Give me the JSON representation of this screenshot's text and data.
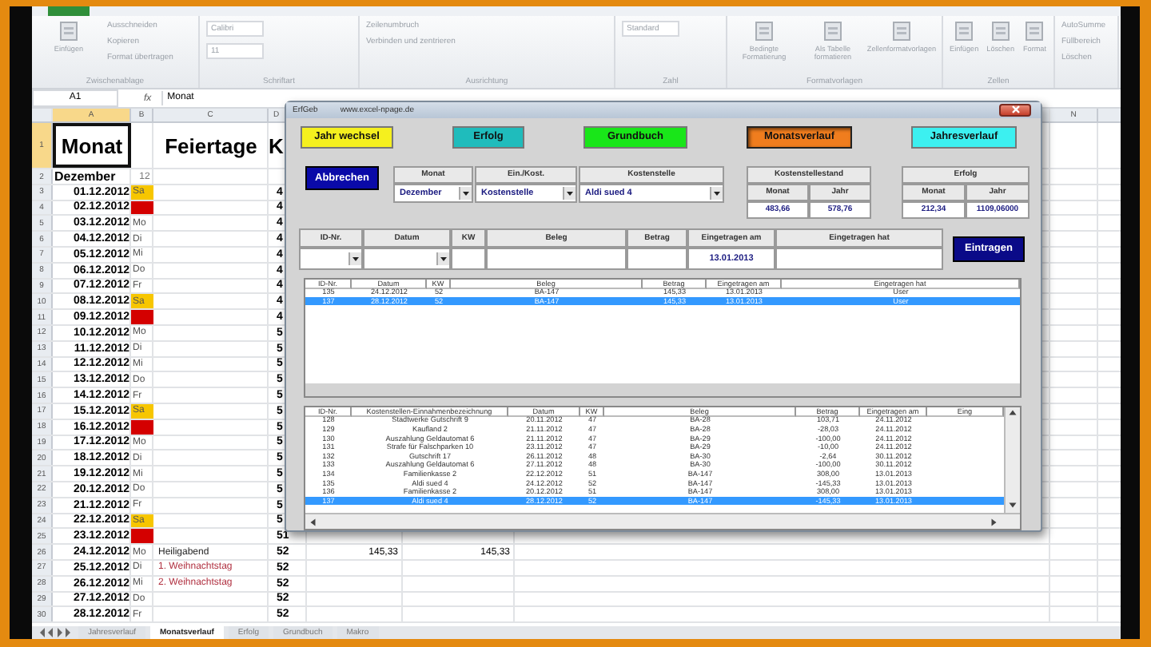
{
  "ribbon": {
    "groups": [
      {
        "label": "Zwischenablage",
        "items": [
          {
            "kind": "large",
            "label": "Einfügen"
          },
          {
            "kind": "small",
            "label": "Ausschneiden"
          },
          {
            "kind": "small",
            "label": "Kopieren"
          },
          {
            "kind": "small",
            "label": "Format übertragen"
          }
        ]
      },
      {
        "label": "Schriftart",
        "items": [
          {
            "kind": "field",
            "label": "Calibri"
          },
          {
            "kind": "field",
            "label": "11"
          }
        ]
      },
      {
        "label": "Ausrichtung",
        "items": [
          {
            "kind": "small",
            "label": "Zeilenumbruch"
          },
          {
            "kind": "small",
            "label": "Verbinden und zentrieren"
          }
        ]
      },
      {
        "label": "Zahl",
        "items": [
          {
            "kind": "field",
            "label": "Standard"
          }
        ]
      },
      {
        "label": "Formatvorlagen",
        "items": [
          {
            "kind": "large",
            "label": "Bedingte Formatierung"
          },
          {
            "kind": "large",
            "label": "Als Tabelle formatieren"
          },
          {
            "kind": "large",
            "label": "Zellenformatvorlagen"
          }
        ]
      },
      {
        "label": "Zellen",
        "items": [
          {
            "kind": "large",
            "label": "Einfügen"
          },
          {
            "kind": "large",
            "label": "Löschen"
          },
          {
            "kind": "large",
            "label": "Format"
          }
        ]
      },
      {
        "items": [
          {
            "kind": "small",
            "label": "AutoSumme"
          },
          {
            "kind": "small",
            "label": "Füllbereich"
          },
          {
            "kind": "small",
            "label": "Löschen"
          }
        ]
      }
    ]
  },
  "formula_bar": {
    "name_box": "A1",
    "function_symbol": "fx",
    "value": "Monat"
  },
  "columns": [
    {
      "label": "A",
      "selected": true
    },
    {
      "label": "B",
      "selected": false
    },
    {
      "label": "C",
      "selected": false
    },
    {
      "label": "D",
      "selected": false
    },
    {
      "label": "N",
      "selected": false
    }
  ],
  "title_row": {
    "num": "1",
    "selected": true,
    "month": "Monat",
    "holidays": "Feiertage",
    "kw": "K"
  },
  "month_row": {
    "num": "2",
    "month": "Dezember",
    "number": "12"
  },
  "rows": [
    {
      "num": "3",
      "date": "01.12.2012",
      "kind": "sa",
      "day": "Sa",
      "kw": "4"
    },
    {
      "num": "4",
      "date": "02.12.2012",
      "kind": "so",
      "kw": "4"
    },
    {
      "num": "5",
      "date": "03.12.2012",
      "kind": "weekday",
      "day": "Mo",
      "kw": "4"
    },
    {
      "num": "6",
      "date": "04.12.2012",
      "kind": "weekday",
      "day": "Di",
      "kw": "4"
    },
    {
      "num": "7",
      "date": "05.12.2012",
      "kind": "weekday",
      "day": "Mi",
      "kw": "4"
    },
    {
      "num": "8",
      "date": "06.12.2012",
      "kind": "weekday",
      "day": "Do",
      "kw": "4"
    },
    {
      "num": "9",
      "date": "07.12.2012",
      "kind": "weekday",
      "day": "Fr",
      "kw": "4"
    },
    {
      "num": "10",
      "date": "08.12.2012",
      "kind": "sa",
      "day": "Sa",
      "kw": "4"
    },
    {
      "num": "11",
      "date": "09.12.2012",
      "kind": "so",
      "kw": "4"
    },
    {
      "num": "12",
      "date": "10.12.2012",
      "kind": "weekday",
      "day": "Mo",
      "kw": "5"
    },
    {
      "num": "13",
      "date": "11.12.2012",
      "kind": "weekday",
      "day": "Di",
      "kw": "5"
    },
    {
      "num": "14",
      "date": "12.12.2012",
      "kind": "weekday",
      "day": "Mi",
      "kw": "5"
    },
    {
      "num": "15",
      "date": "13.12.2012",
      "kind": "weekday",
      "day": "Do",
      "kw": "5"
    },
    {
      "num": "16",
      "date": "14.12.2012",
      "kind": "weekday",
      "day": "Fr",
      "kw": "5"
    },
    {
      "num": "17",
      "date": "15.12.2012",
      "kind": "sa",
      "day": "Sa",
      "kw": "5"
    },
    {
      "num": "18",
      "date": "16.12.2012",
      "kind": "so",
      "kw": "5"
    },
    {
      "num": "19",
      "date": "17.12.2012",
      "kind": "weekday",
      "day": "Mo",
      "kw": "5"
    },
    {
      "num": "20",
      "date": "18.12.2012",
      "kind": "weekday",
      "day": "Di",
      "kw": "5"
    },
    {
      "num": "21",
      "date": "19.12.2012",
      "kind": "weekday",
      "day": "Mi",
      "kw": "5"
    },
    {
      "num": "22",
      "date": "20.12.2012",
      "kind": "weekday",
      "day": "Do",
      "kw": "5"
    },
    {
      "num": "23",
      "date": "21.12.2012",
      "kind": "weekday",
      "day": "Fr",
      "kw": "5"
    },
    {
      "num": "24",
      "date": "22.12.2012",
      "kind": "sa",
      "day": "Sa",
      "kw": "5"
    },
    {
      "num": "25",
      "date": "23.12.2012",
      "kind": "so",
      "kw": "51"
    },
    {
      "num": "26",
      "date": "24.12.2012",
      "kind": "weekday",
      "day": "Mo",
      "holiday": "Heiligabend",
      "color": "#222222",
      "kw": "52",
      "value_e": "145,33",
      "value_f": "145,33"
    },
    {
      "num": "27",
      "date": "25.12.2012",
      "kind": "weekday",
      "day": "Di",
      "holiday": "1. Weihnachtstag",
      "color": "#b03040",
      "kw": "52"
    },
    {
      "num": "28",
      "date": "26.12.2012",
      "kind": "weekday",
      "day": "Mi",
      "holiday": "2. Weihnachtstag",
      "color": "#b03040",
      "kw": "52"
    },
    {
      "num": "29",
      "date": "27.12.2012",
      "kind": "weekday",
      "day": "Do",
      "kw": "52"
    },
    {
      "num": "30",
      "date": "28.12.2012",
      "kind": "weekday",
      "day": "Fr",
      "kw": "52"
    }
  ],
  "sheet_tabs": [
    {
      "label": "Jahresverlauf",
      "selected": false
    },
    {
      "label": "Monatsverlauf",
      "selected": true
    },
    {
      "label": "Erfolg",
      "selected": false
    },
    {
      "label": "Grundbuch",
      "selected": false
    },
    {
      "label": "Makro",
      "selected": false
    }
  ],
  "form": {
    "title": "ErfGeb",
    "url": "www.excel-npage.de",
    "nav_buttons": [
      {
        "label": "Jahr wechsel",
        "color": "#f5f01e",
        "selected": false
      },
      {
        "label": "Erfolg",
        "color": "#1fbcbc",
        "selected": false
      },
      {
        "label": "Grundbuch",
        "color": "#19e619",
        "selected": false
      },
      {
        "label": "Monatsverlauf",
        "color": "#f07d1e",
        "selected": true
      },
      {
        "label": "Jahresverlauf",
        "color": "#3cf0f0",
        "selected": false
      }
    ],
    "cancel_button": "Abbrechen",
    "filters": [
      {
        "label": "Monat",
        "value": "Dezember"
      },
      {
        "label": "Ein./Kost.",
        "value": "Kostenstelle"
      },
      {
        "label": "Kostenstelle",
        "value": "Aldi sued 4"
      }
    ],
    "balance": {
      "title": "Kostenstellestand",
      "columns": [
        "Monat",
        "Jahr"
      ],
      "values": [
        "483,66",
        "578,76"
      ]
    },
    "result": {
      "title": "Erfolg",
      "columns": [
        "Monat",
        "Jahr"
      ],
      "values": [
        "212,34",
        "1109,06000"
      ]
    },
    "entry": {
      "fields": [
        {
          "label": "ID-Nr.",
          "kind": "combo"
        },
        {
          "label": "Datum",
          "kind": "combo"
        },
        {
          "label": "KW",
          "kind": "text"
        },
        {
          "label": "Beleg",
          "kind": "text"
        },
        {
          "label": "Betrag",
          "kind": "text"
        },
        {
          "label": "Eingetragen am",
          "kind": "text",
          "value": "13.01.2013"
        },
        {
          "label": "Eingetragen hat",
          "kind": "text"
        }
      ],
      "submit": "Eintragen"
    },
    "list_1": {
      "columns": [
        "ID-Nr.",
        "Datum",
        "KW",
        "Beleg",
        "Betrag",
        "Eingetragen am",
        "Eingetragen hat"
      ],
      "rows": [
        {
          "cells": [
            "135",
            "24.12.2012",
            "52",
            "BA-147",
            "145,33",
            "13.01.2013",
            "User"
          ],
          "selected": false
        },
        {
          "cells": [
            "137",
            "28.12.2012",
            "52",
            "BA-147",
            "145,33",
            "13.01.2013",
            "User"
          ],
          "selected": true
        }
      ]
    },
    "list_2": {
      "columns": [
        "ID-Nr.",
        "Kostenstellen-Einnahmenbezeichnung",
        "Datum",
        "KW",
        "Beleg",
        "Betrag",
        "Eingetragen am",
        "Eing"
      ],
      "rows": [
        {
          "cells": [
            "128",
            "Stadtwerke Gutschrift 9",
            "20.11.2012",
            "47",
            "BA-28",
            "103,71",
            "24.11.2012"
          ],
          "selected": false
        },
        {
          "cells": [
            "129",
            "Kaufland 2",
            "21.11.2012",
            "47",
            "BA-28",
            "-28,03",
            "24.11.2012"
          ],
          "selected": false
        },
        {
          "cells": [
            "130",
            "Auszahlung Geldautomat 6",
            "21.11.2012",
            "47",
            "BA-29",
            "-100,00",
            "24.11.2012"
          ],
          "selected": false
        },
        {
          "cells": [
            "131",
            "Strafe für Falschparken 10",
            "23.11.2012",
            "47",
            "BA-29",
            "-10,00",
            "24.11.2012"
          ],
          "selected": false
        },
        {
          "cells": [
            "132",
            "Gutschrift 17",
            "26.11.2012",
            "48",
            "BA-30",
            "-2,64",
            "30.11.2012"
          ],
          "selected": false
        },
        {
          "cells": [
            "133",
            "Auszahlung Geldautomat 6",
            "27.11.2012",
            "48",
            "BA-30",
            "-100,00",
            "30.11.2012"
          ],
          "selected": false
        },
        {
          "cells": [
            "134",
            "Familienkasse 2",
            "22.12.2012",
            "51",
            "BA-147",
            "308,00",
            "13.01.2013"
          ],
          "selected": false
        },
        {
          "cells": [
            "135",
            "Aldi sued 4",
            "24.12.2012",
            "52",
            "BA-147",
            "-145,33",
            "13.01.2013"
          ],
          "selected": false
        },
        {
          "cells": [
            "136",
            "Familienkasse 2",
            "20.12.2012",
            "51",
            "BA-147",
            "308,00",
            "13.01.2013"
          ],
          "selected": false
        },
        {
          "cells": [
            "137",
            "Aldi sued 4",
            "28.12.2012",
            "52",
            "BA-147",
            "-145,33",
            "13.01.2013"
          ],
          "selected": true
        }
      ]
    }
  }
}
